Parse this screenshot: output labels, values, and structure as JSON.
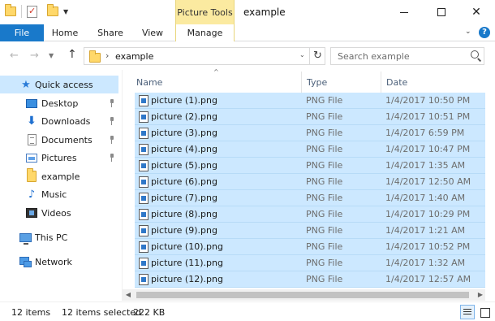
{
  "titlebar": {
    "context_tab": "Picture Tools",
    "window_title": "example",
    "close_glyph": "✕"
  },
  "ribbon": {
    "tabs": [
      "File",
      "Home",
      "Share",
      "View",
      "Manage"
    ],
    "help": "?"
  },
  "address": {
    "path": "example",
    "search_placeholder": "Search example"
  },
  "sidebar": {
    "items": [
      {
        "label": "Quick access",
        "icon": "star-icon"
      },
      {
        "label": "Desktop",
        "icon": "desktop-icon"
      },
      {
        "label": "Downloads",
        "icon": "download-icon"
      },
      {
        "label": "Documents",
        "icon": "documents-icon"
      },
      {
        "label": "Pictures",
        "icon": "pictures-icon"
      },
      {
        "label": "example",
        "icon": "folder-icon"
      },
      {
        "label": "Music",
        "icon": "music-icon"
      },
      {
        "label": "Videos",
        "icon": "videos-icon"
      },
      {
        "label": "This PC",
        "icon": "computer-icon"
      },
      {
        "label": "Network",
        "icon": "network-icon"
      }
    ]
  },
  "columns": {
    "name": "Name",
    "type": "Type",
    "date": "Date"
  },
  "files": [
    {
      "name": "picture (1).png",
      "type": "PNG File",
      "date": "1/4/2017 10:50 PM"
    },
    {
      "name": "picture (2).png",
      "type": "PNG File",
      "date": "1/4/2017 10:51 PM"
    },
    {
      "name": "picture (3).png",
      "type": "PNG File",
      "date": "1/4/2017 6:59 PM"
    },
    {
      "name": "picture (4).png",
      "type": "PNG File",
      "date": "1/4/2017 10:47 PM"
    },
    {
      "name": "picture (5).png",
      "type": "PNG File",
      "date": "1/4/2017 1:35 AM"
    },
    {
      "name": "picture (6).png",
      "type": "PNG File",
      "date": "1/4/2017 12:50 AM"
    },
    {
      "name": "picture (7).png",
      "type": "PNG File",
      "date": "1/4/2017 1:40 AM"
    },
    {
      "name": "picture (8).png",
      "type": "PNG File",
      "date": "1/4/2017 10:29 PM"
    },
    {
      "name": "picture (9).png",
      "type": "PNG File",
      "date": "1/4/2017 1:21 AM"
    },
    {
      "name": "picture (10).png",
      "type": "PNG File",
      "date": "1/4/2017 10:52 PM"
    },
    {
      "name": "picture (11).png",
      "type": "PNG File",
      "date": "1/4/2017 1:32 AM"
    },
    {
      "name": "picture (12).png",
      "type": "PNG File",
      "date": "1/4/2017 12:57 AM"
    }
  ],
  "status": {
    "item_count": "12 items",
    "selected": "12 items selected",
    "size": "222 KB"
  },
  "colors": {
    "accent": "#1979ca",
    "selection": "#cce8ff",
    "context_tab": "#fbeaa0"
  }
}
